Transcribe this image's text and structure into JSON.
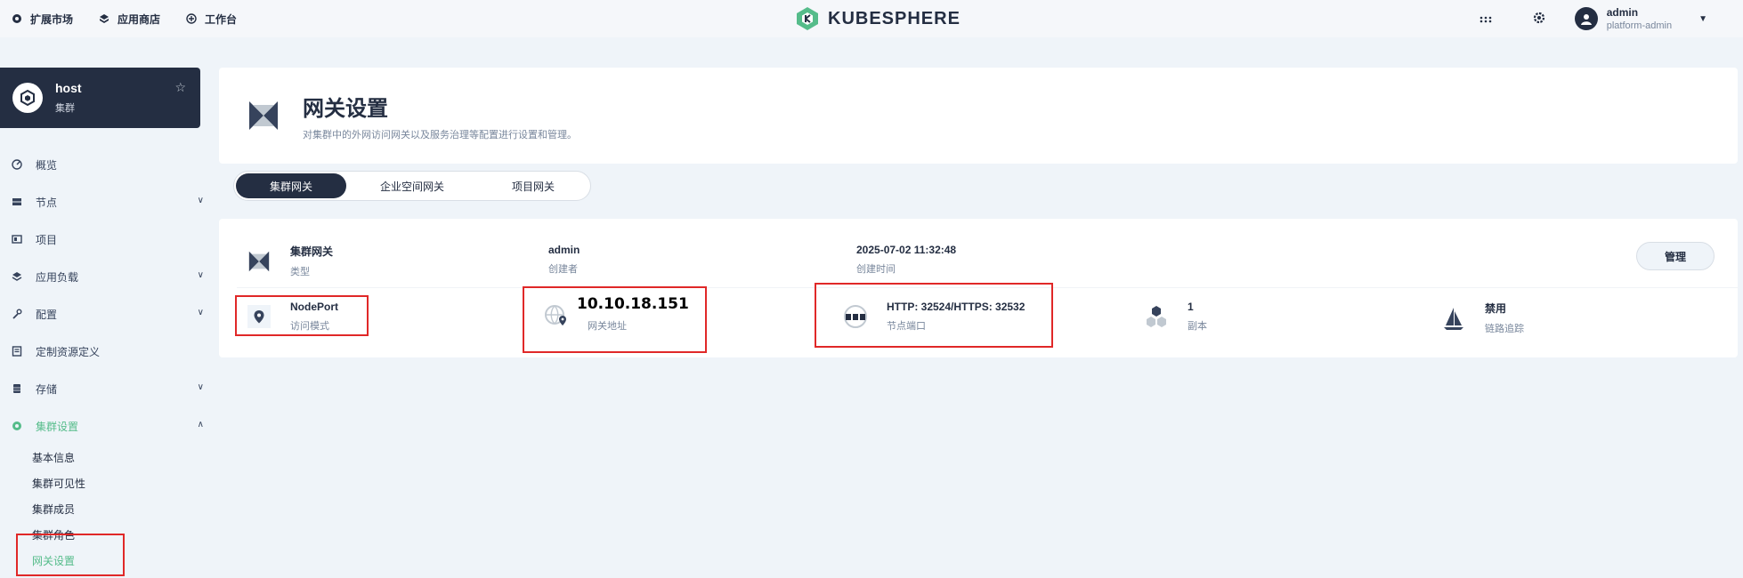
{
  "topbar": {
    "links": [
      {
        "label": "扩展市场",
        "icon": "puzzle-icon"
      },
      {
        "label": "应用商店",
        "icon": "cube-icon"
      },
      {
        "label": "工作台",
        "icon": "grid-icon"
      }
    ],
    "brand": "KUBESPHERE",
    "user_name": "admin",
    "user_role": "platform-admin"
  },
  "cluster": {
    "name": "host",
    "type": "集群"
  },
  "nav": {
    "items": [
      {
        "label": "概览"
      },
      {
        "label": "节点"
      },
      {
        "label": "项目"
      },
      {
        "label": "应用负载"
      },
      {
        "label": "配置"
      },
      {
        "label": "定制资源定义"
      },
      {
        "label": "存储"
      },
      {
        "label": "集群设置"
      }
    ],
    "sub_items": [
      {
        "label": "基本信息"
      },
      {
        "label": "集群可见性"
      },
      {
        "label": "集群成员"
      },
      {
        "label": "集群角色"
      },
      {
        "label": "网关设置"
      }
    ]
  },
  "header": {
    "title": "网关设置",
    "description": "对集群中的外网访问网关以及服务治理等配置进行设置和管理。"
  },
  "tabs": [
    {
      "label": "集群网关"
    },
    {
      "label": "企业空间网关"
    },
    {
      "label": "项目网关"
    }
  ],
  "gateway": {
    "type_value": "集群网关",
    "type_label": "类型",
    "creator_value": "admin",
    "creator_label": "创建者",
    "created_value": "2025-07-02 11:32:48",
    "created_label": "创建时间",
    "manage_label": "管理",
    "access_mode_value": "NodePort",
    "access_mode_label": "访问模式",
    "address_value": "10.10.18.151",
    "address_label": "网关地址",
    "ports_value": "HTTP: 32524/HTTPS: 32532",
    "ports_label": "节点端口",
    "replicas_value": "1",
    "replicas_label": "副本",
    "tracing_value": "禁用",
    "tracing_label": "链路追踪"
  },
  "colors": {
    "accent": "#55bc8a",
    "dark": "#242e42",
    "highlight": "#e02828"
  }
}
